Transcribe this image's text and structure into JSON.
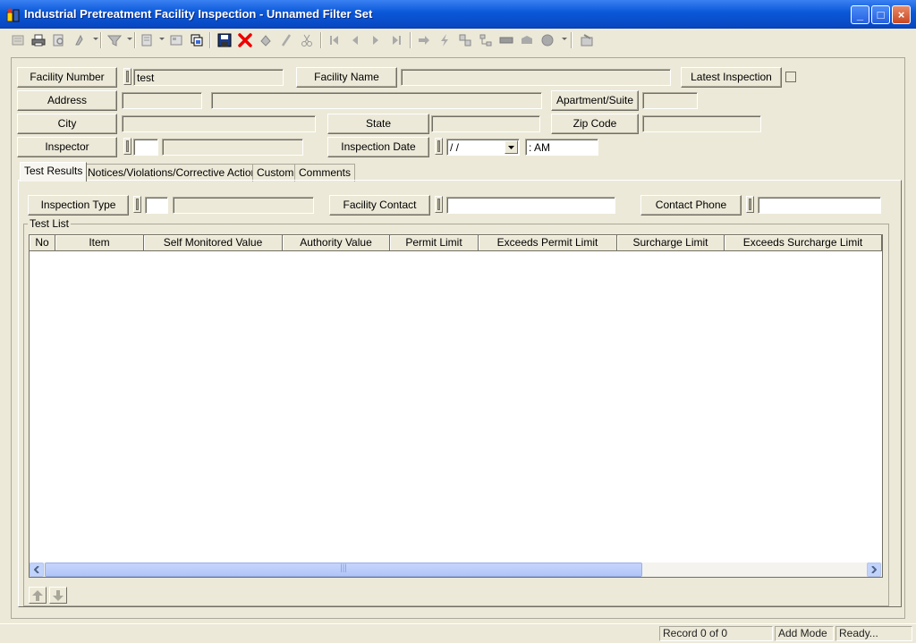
{
  "window": {
    "title": "Industrial Pretreatment Facility Inspection - Unnamed Filter Set",
    "minimize": "_",
    "maximize": "□",
    "close": "×"
  },
  "form": {
    "facility_number": {
      "label": "Facility Number",
      "value": "test"
    },
    "facility_name": {
      "label": "Facility Name",
      "value": ""
    },
    "latest_inspection": {
      "label": "Latest Inspection"
    },
    "address": {
      "label": "Address",
      "value1": "",
      "value2": ""
    },
    "apartment_suite": {
      "label": "Apartment/Suite",
      "value": ""
    },
    "city": {
      "label": "City",
      "value": ""
    },
    "state": {
      "label": "State",
      "value": ""
    },
    "zip_code": {
      "label": "Zip Code",
      "value": ""
    },
    "inspector": {
      "label": "Inspector",
      "code": "",
      "name": ""
    },
    "inspection_date": {
      "label": "Inspection Date",
      "date": " /  /",
      "time": " :  AM"
    }
  },
  "tabs": [
    {
      "label": "Test Results"
    },
    {
      "label": "Notices/Violations/Corrective Actions"
    },
    {
      "label": "Custom"
    },
    {
      "label": "Comments"
    }
  ],
  "test_results": {
    "inspection_type": {
      "label": "Inspection Type",
      "code": "",
      "desc": ""
    },
    "facility_contact": {
      "label": "Facility Contact",
      "value": ""
    },
    "contact_phone": {
      "label": "Contact Phone",
      "value": ""
    },
    "group_label": "Test List",
    "columns": [
      "No",
      "Item",
      "Self Monitored Value",
      "Authority Value",
      "Permit Limit",
      "Exceeds Permit Limit",
      "Surcharge Limit",
      "Exceeds Surcharge Limit"
    ],
    "thumb_grip": "|||"
  },
  "status": {
    "record": "Record 0 of 0",
    "mode": "Add Mode",
    "state": "Ready..."
  }
}
